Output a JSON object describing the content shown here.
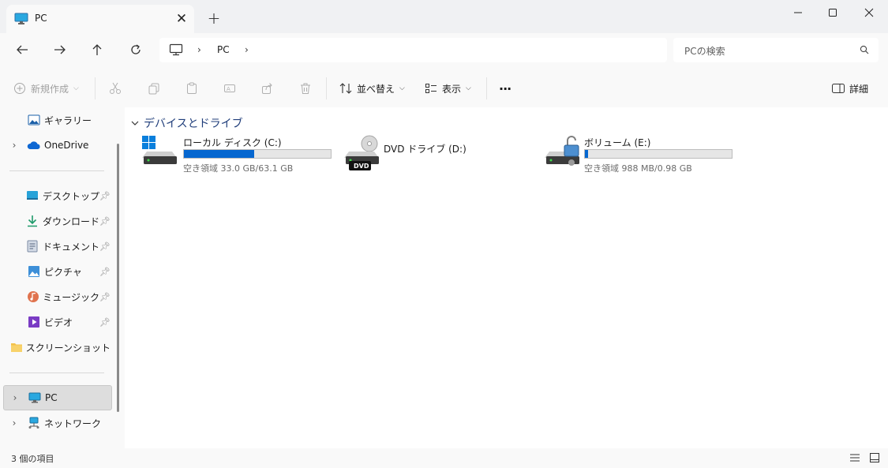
{
  "window": {
    "tab_title": "PC",
    "tab_close": "✕",
    "new_tab": "+"
  },
  "address": {
    "path": [
      "PC"
    ],
    "search_placeholder": "PCの検索"
  },
  "toolbar": {
    "new_label": "新規作成",
    "sort_label": "並べ替え",
    "view_label": "表示",
    "more_label": "···",
    "details_label": "詳細"
  },
  "sidebar": {
    "gallery": "ギャラリー",
    "onedrive": "OneDrive",
    "pinned": [
      {
        "label": "デスクトップ",
        "icon": "desktop-icon"
      },
      {
        "label": "ダウンロード",
        "icon": "download-icon"
      },
      {
        "label": "ドキュメント",
        "icon": "document-icon"
      },
      {
        "label": "ピクチャ",
        "icon": "picture-icon"
      },
      {
        "label": "ミュージック",
        "icon": "music-icon"
      },
      {
        "label": "ビデオ",
        "icon": "video-icon"
      }
    ],
    "screenshots": "スクリーンショット",
    "pc": "PC",
    "network": "ネットワーク"
  },
  "content": {
    "group_title": "デバイスとドライブ",
    "drives": [
      {
        "name": "ローカル ディスク (C:)",
        "info": "空き領域 33.0 GB/63.1 GB",
        "used_fraction": 0.477
      },
      {
        "name": "DVD ドライブ (D:)",
        "badge": "DVD"
      },
      {
        "name": "ボリューム (E:)",
        "info": "空き領域 988 MB/0.98 GB",
        "used_fraction": 0.02
      }
    ]
  },
  "status": {
    "item_count": "3 個の項目"
  },
  "colors": {
    "accent": "#0667d0",
    "group_header": "#1f3d7a"
  }
}
